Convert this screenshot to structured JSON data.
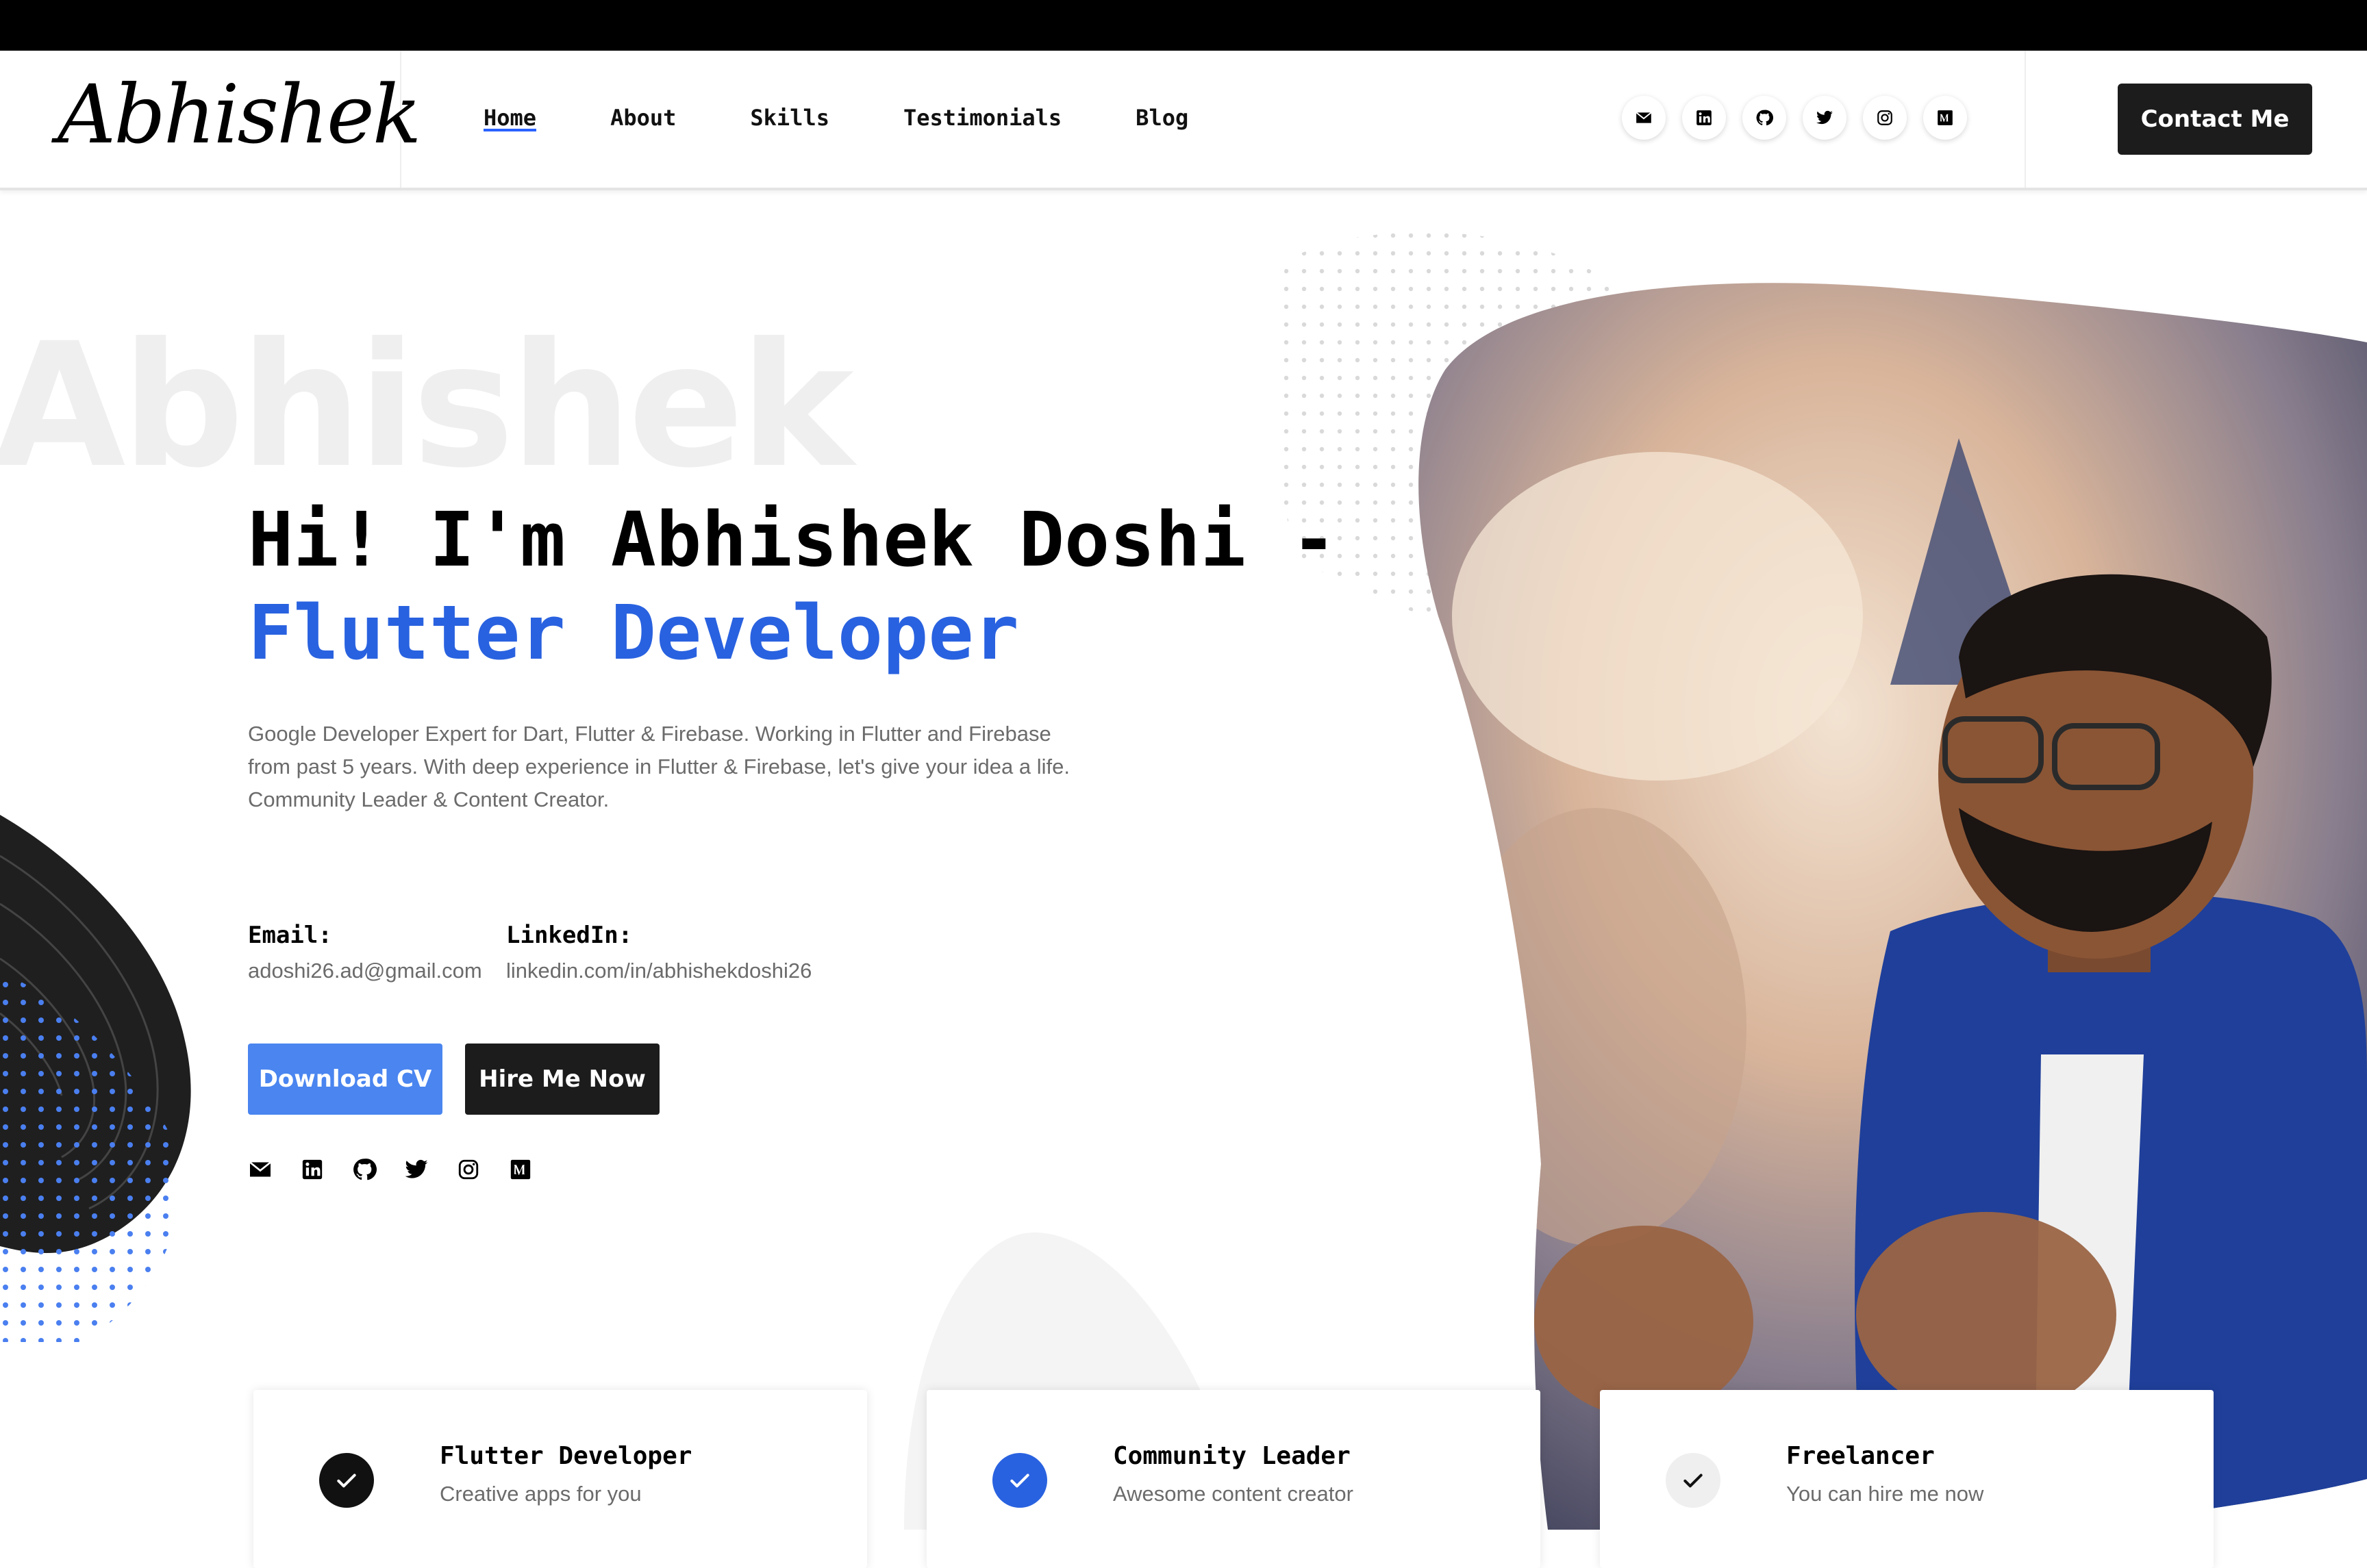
{
  "header": {
    "logo": "Abhishek",
    "nav": [
      {
        "label": "Home",
        "active": true
      },
      {
        "label": "About"
      },
      {
        "label": "Skills"
      },
      {
        "label": "Testimonials"
      },
      {
        "label": "Blog"
      }
    ],
    "social_icons": [
      "envelope-icon",
      "linkedin-icon",
      "github-icon",
      "twitter-icon",
      "instagram-icon",
      "medium-icon"
    ],
    "contact_label": "Contact Me"
  },
  "hero": {
    "watermark": "Abhishek",
    "title_line1": "Hi! I'm Abhishek Doshi -",
    "title_line2": "Flutter Developer",
    "description": "Google Developer Expert for Dart, Flutter & Firebase. Working in Flutter and Firebase from past 5 years. With deep experience in Flutter & Firebase, let's give your idea a life. Community Leader & Content Creator.",
    "email_label": "Email:",
    "email_value": "adoshi26.ad@gmail.com",
    "linkedin_label": "LinkedIn:",
    "linkedin_value": "linkedin.com/in/abhishekdoshi26",
    "download_cv_label": "Download CV",
    "hire_label": "Hire Me Now",
    "social_icons": [
      "envelope-icon",
      "linkedin-icon",
      "github-icon",
      "twitter-icon",
      "instagram-icon",
      "medium-icon"
    ]
  },
  "cards": [
    {
      "title": "Flutter Developer",
      "subtitle": "Creative apps for you",
      "badge_color": "#111111"
    },
    {
      "title": "Community Leader",
      "subtitle": "Awesome content creator",
      "badge_color": "#2962e0"
    },
    {
      "title": "Freelancer",
      "subtitle": "You can hire me now",
      "badge_color": "#efefef"
    }
  ],
  "colors": {
    "accent": "#2962e0",
    "button_blue": "#4a85f0",
    "dark": "#1c1c1c",
    "text_muted": "#6b6b6b"
  }
}
